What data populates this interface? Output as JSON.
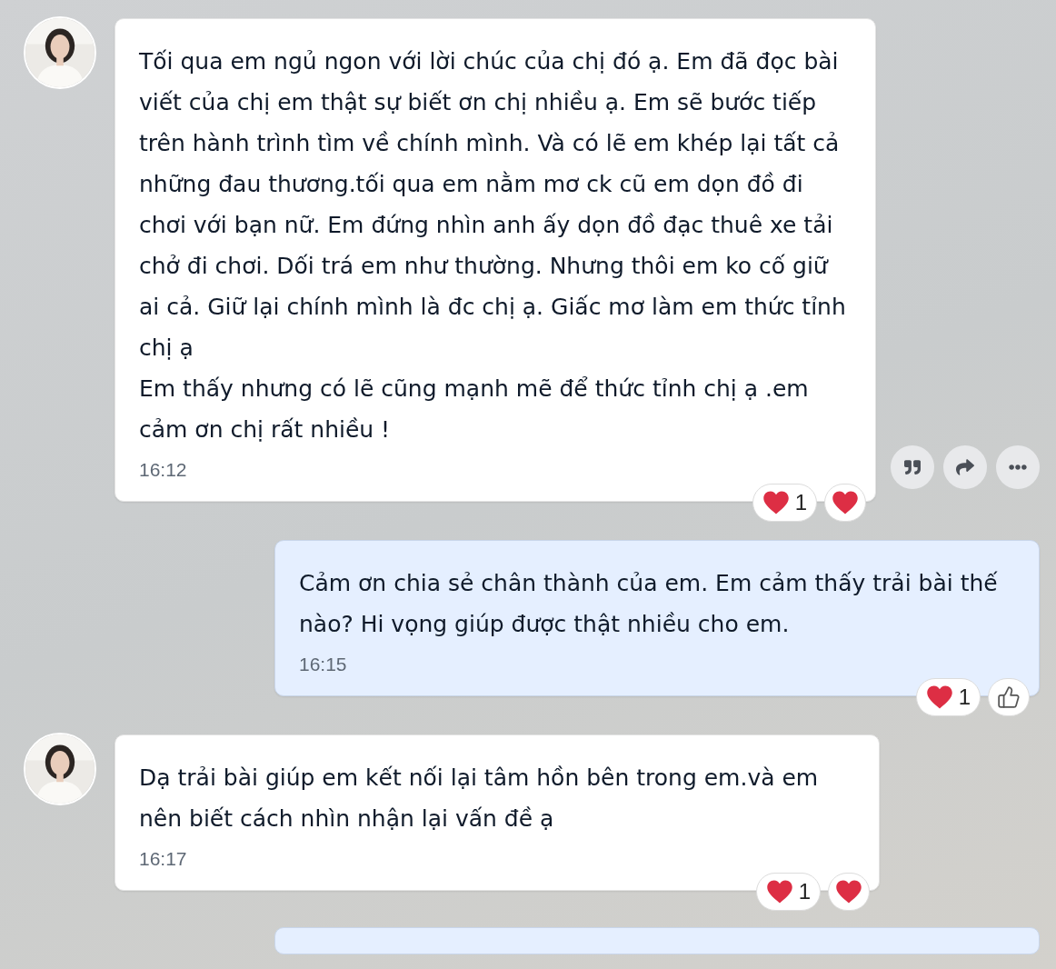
{
  "messages": [
    {
      "kind": "received",
      "paragraphs": [
        "Tối qua em ngủ ngon với lời chúc của chị đó ạ. Em đã đọc bài viết của chị em thật sự biết ơn chị nhiều ạ. Em sẽ bước tiếp trên hành trình tìm về chính mình. Và có lẽ em khép lại tất cả những đau thương.tối qua em nằm mơ ck cũ em dọn đồ đi chơi với bạn nữ. Em đứng nhìn anh ấy dọn đồ đạc thuê xe tải chở đi chơi. Dối trá em như thường. Nhưng thôi em ko cố giữ ai cả. Giữ lại chính mình là đc chị ạ. Giấc mơ làm em thức tỉnh chị ạ",
        "Em thấy nhưng có lẽ cũng mạnh mẽ để thức tỉnh chị ạ .em cảm ơn chị rất nhiều !"
      ],
      "time": "16:12",
      "reaction_count": "1",
      "quick_reaction": {
        "kind": "heart"
      },
      "actions": [
        {
          "kind": "quote"
        },
        {
          "kind": "share"
        },
        {
          "kind": "more"
        }
      ]
    },
    {
      "kind": "sent",
      "paragraphs": [
        "Cảm ơn chia sẻ chân thành của em. Em cảm thấy trải bài thế nào? Hi vọng giúp được thật nhiều cho em."
      ],
      "time": "16:15",
      "reaction_count": "1",
      "quick_reaction": {
        "kind": "like"
      }
    },
    {
      "kind": "received",
      "paragraphs": [
        "Dạ trải bài giúp em kết nối lại tâm hồn bên trong em.và em nên biết cách nhìn nhận lại vấn đề ạ"
      ],
      "time": "16:17",
      "reaction_count": "1",
      "quick_reaction": {
        "kind": "heart"
      }
    },
    {
      "kind": "sent"
    }
  ]
}
